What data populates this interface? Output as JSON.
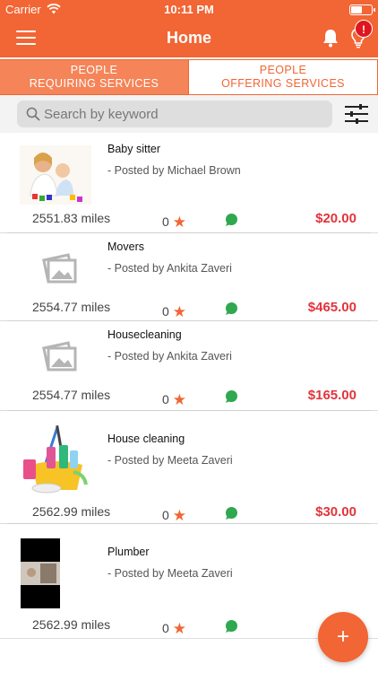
{
  "status_bar": {
    "carrier": "Carrier",
    "time": "10:11 PM"
  },
  "header": {
    "title": "Home",
    "notification_badge": "!"
  },
  "tabs": [
    {
      "line1": "PEOPLE",
      "line2": "REQUIRING SERVICES",
      "active": true
    },
    {
      "line1": "PEOPLE",
      "line2": "OFFERING SERVICES",
      "active": false
    }
  ],
  "search": {
    "placeholder": "Search by keyword",
    "value": ""
  },
  "listings": [
    {
      "title": "Baby sitter",
      "posted_by": "- Posted by Michael Brown",
      "distance": "2551.83 miles",
      "rating": "0",
      "price": "$20.00",
      "image": "photo-baby"
    },
    {
      "title": "Movers",
      "posted_by": "- Posted by Ankita Zaveri",
      "distance": "2554.77 miles",
      "rating": "0",
      "price": "$465.00",
      "image": "placeholder"
    },
    {
      "title": "Housecleaning",
      "posted_by": "- Posted by Ankita Zaveri",
      "distance": "2554.77 miles",
      "rating": "0",
      "price": "$165.00",
      "image": "placeholder"
    },
    {
      "title": "House cleaning",
      "posted_by": "- Posted by Meeta Zaveri",
      "distance": "2562.99 miles",
      "rating": "0",
      "price": "$30.00",
      "image": "photo-cleaning"
    },
    {
      "title": "Plumber",
      "posted_by": "- Posted by Meeta Zaveri",
      "distance": "2562.99 miles",
      "rating": "0",
      "price": "$",
      "image": "photo-plumber"
    }
  ],
  "fab": {
    "label": "+"
  },
  "colors": {
    "accent": "#f26534",
    "price": "#e2343c",
    "chat": "#2fa84f",
    "badge": "#e0161e"
  }
}
